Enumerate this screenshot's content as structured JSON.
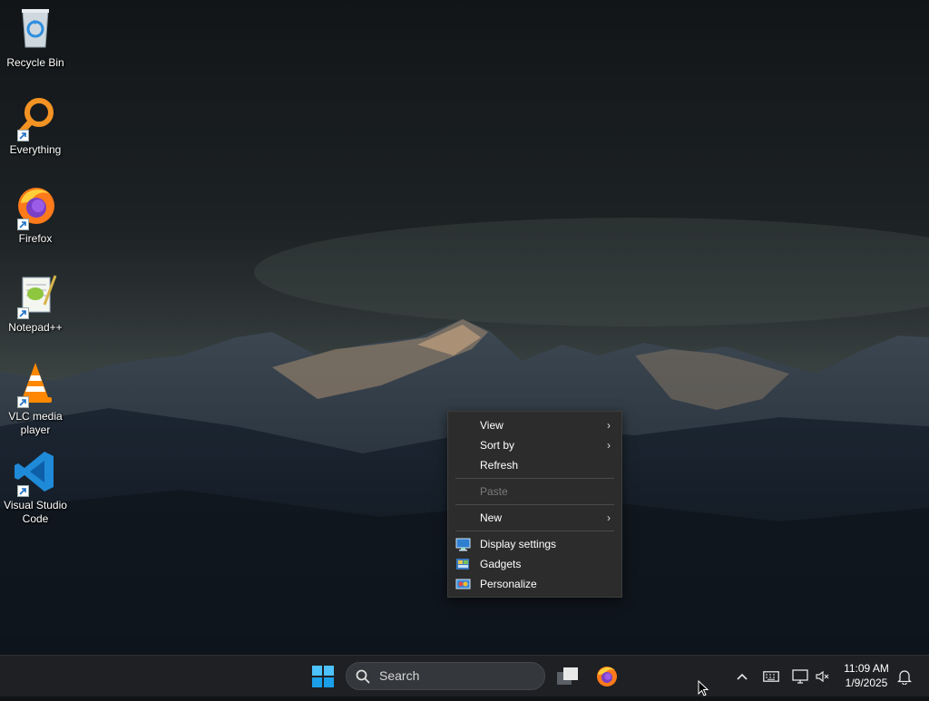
{
  "desktop": {
    "icons": [
      {
        "label": "Recycle Bin",
        "icon": "recycle-bin-icon"
      },
      {
        "label": "Everything",
        "icon": "everything-search-icon"
      },
      {
        "label": "Firefox",
        "icon": "firefox-icon"
      },
      {
        "label": "Notepad++",
        "icon": "notepad-plus-plus-icon"
      },
      {
        "label": "VLC media player",
        "icon": "vlc-icon"
      },
      {
        "label": "Visual Studio Code",
        "icon": "vscode-icon"
      }
    ]
  },
  "context_menu": {
    "items": [
      {
        "label": "View",
        "submenu": true,
        "enabled": true
      },
      {
        "label": "Sort by",
        "submenu": true,
        "enabled": true
      },
      {
        "label": "Refresh",
        "submenu": false,
        "enabled": true
      },
      {
        "label": "Paste",
        "submenu": false,
        "enabled": false
      },
      {
        "label": "New",
        "submenu": true,
        "enabled": true
      },
      {
        "label": "Display settings",
        "icon": "display-icon",
        "submenu": false,
        "enabled": true
      },
      {
        "label": "Gadgets",
        "icon": "gadgets-icon",
        "submenu": false,
        "enabled": true
      },
      {
        "label": "Personalize",
        "icon": "personalize-icon",
        "submenu": false,
        "enabled": true
      }
    ],
    "submenu_arrow": "›"
  },
  "taskbar": {
    "search_label": "Search",
    "apps": [
      "start-icon",
      "task-view-icon",
      "firefox-icon"
    ],
    "tray": [
      "chevron-up-icon",
      "keyboard-icon",
      "network-icon",
      "volume-muted-icon",
      "notification-bell-icon"
    ],
    "clock": {
      "time": "11:09 AM",
      "date": "1/9/2025"
    }
  },
  "colors": {
    "accent": "#0078d4",
    "menu_bg": "#2c2c2c",
    "taskbar_bg": "#1e2023"
  }
}
